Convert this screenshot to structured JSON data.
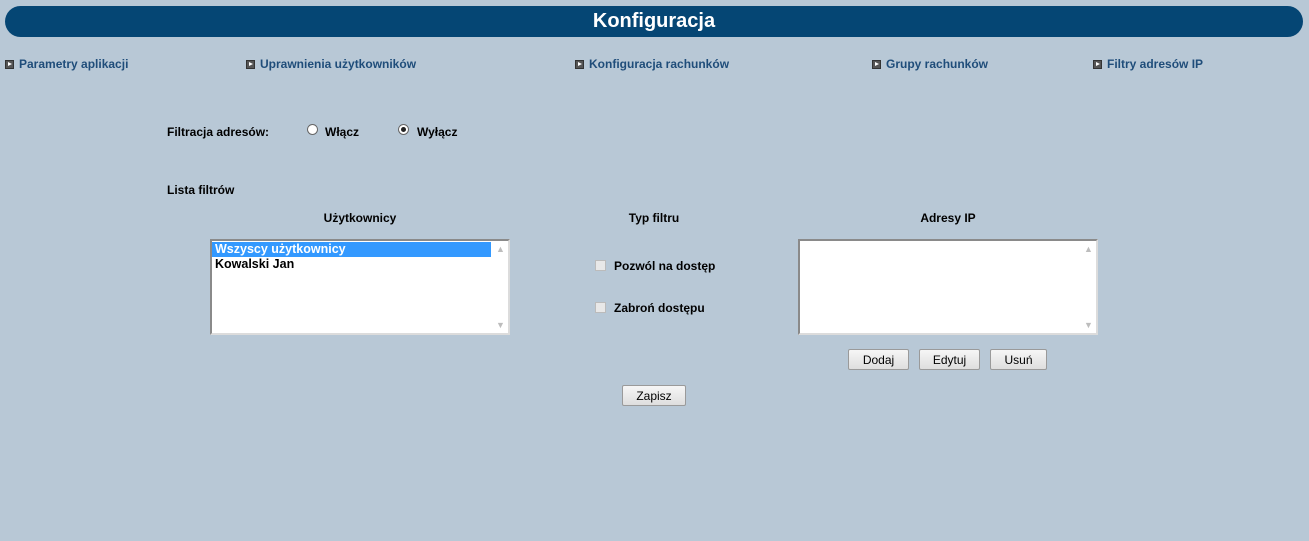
{
  "header": {
    "title": "Konfiguracja"
  },
  "nav": {
    "items": [
      {
        "label": "Parametry aplikacji"
      },
      {
        "label": "Uprawnienia użytkowników"
      },
      {
        "label": "Konfiguracja rachunków"
      },
      {
        "label": "Grupy rachunków"
      },
      {
        "label": "Filtry adresów IP"
      }
    ]
  },
  "filtering": {
    "label": "Filtracja adresów:",
    "options": [
      {
        "label": "Włącz",
        "checked": false
      },
      {
        "label": "Wyłącz",
        "checked": true
      }
    ]
  },
  "filter_list": {
    "title": "Lista filtrów",
    "users_header": "Użytkownicy",
    "users": [
      {
        "label": "Wszyscy użytkownicy",
        "selected": true
      },
      {
        "label": "Kowalski Jan",
        "selected": false
      }
    ],
    "type_header": "Typ filtru",
    "types": [
      {
        "label": "Pozwól na dostęp",
        "checked": false
      },
      {
        "label": "Zabroń dostępu",
        "checked": false
      }
    ],
    "ip_header": "Adresy IP",
    "ip_addresses": []
  },
  "buttons": {
    "add": "Dodaj",
    "edit": "Edytuj",
    "remove": "Usuń",
    "save": "Zapisz"
  }
}
